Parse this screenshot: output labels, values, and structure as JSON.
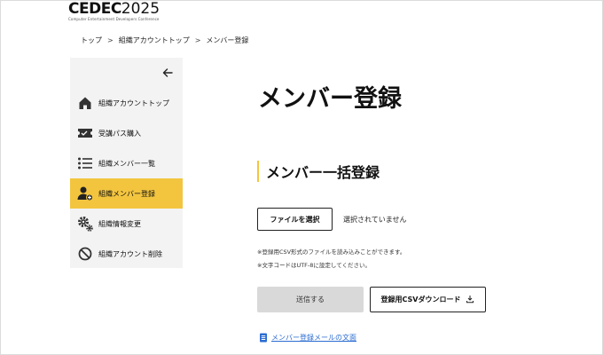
{
  "header": {
    "logo_main": "CEDEC",
    "logo_year": "2025",
    "logo_sub": "Computer Entertainment Developers Conference"
  },
  "breadcrumb": [
    {
      "label": "トップ"
    },
    {
      "label": "組織アカウントトップ"
    },
    {
      "label": "メンバー登録"
    }
  ],
  "breadcrumb_sep": ">",
  "sidebar": {
    "items": [
      {
        "label": "組織アカウントトップ",
        "icon": "home-icon"
      },
      {
        "label": "受講パス購入",
        "icon": "ticket-icon"
      },
      {
        "label": "組織メンバー一覧",
        "icon": "list-icon"
      },
      {
        "label": "組織メンバー登録",
        "icon": "add-user-icon",
        "active": true
      },
      {
        "label": "組織情報変更",
        "icon": "gear-icon"
      },
      {
        "label": "組織アカウント削除",
        "icon": "prohibit-icon"
      }
    ]
  },
  "main": {
    "title": "メンバー登録",
    "section_title": "メンバー一括登録",
    "file_button": "ファイルを選択",
    "file_status": "選択されていません",
    "notes": [
      "※登録用CSV形式のファイルを読み込みことができます。",
      "※文字コードはUTF-8に設定してください。"
    ],
    "send_button": "送信する",
    "download_button": "登録用CSVダウンロード",
    "doc_link": "メンバー登録メールの文面"
  },
  "colors": {
    "accent": "#f3c53f",
    "link": "#2b6cd1",
    "disabled_button": "#d9d9d9",
    "sidebar_bg": "#f3f3f3"
  }
}
